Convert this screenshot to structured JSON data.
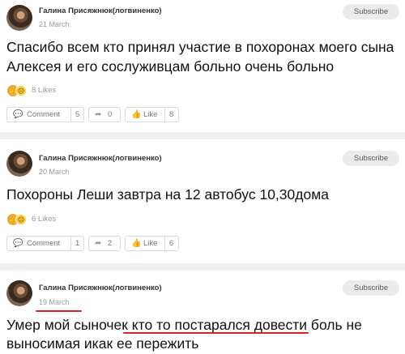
{
  "posts": [
    {
      "author": "Галина Присяжнюк(логвиненко)",
      "date": "21 March",
      "subscribe_label": "Subscribe",
      "text_lines": [
        "Спасибо всем кто принял участие в похоронах моего сына",
        "Алексея и его сослуживцам больно очень больно"
      ],
      "likes_label": "8 Likes",
      "comment_label": "Comment",
      "comment_count": "5",
      "share_count": "0",
      "like_label": "Like",
      "like_count": "8"
    },
    {
      "author": "Галина Присяжнюк(логвиненко)",
      "date": "20 March",
      "subscribe_label": "Subscribe",
      "text_lines": [
        "Похороны Леши завтра на 12 автобус 10,30дома"
      ],
      "likes_label": "6 Likes",
      "comment_label": "Comment",
      "comment_count": "1",
      "share_count": "2",
      "like_label": "Like",
      "like_count": "6"
    },
    {
      "author": "Галина Присяжнюк(логвиненко)",
      "date": "19 March",
      "subscribe_label": "Subscribe",
      "text_lines": [
        "Умер мой сыночек кто то постарался довести боль не",
        "выносимая икак ее пережить"
      ]
    }
  ],
  "icons": {
    "comment": "comment-icon",
    "share": "share-icon",
    "like": "thumbs-up-icon",
    "reaction_like": "like-reaction-icon",
    "reaction_sad": "sad-reaction-icon"
  },
  "colors": {
    "annotation_underline": "#e02020",
    "reaction_like": "#f5a623",
    "reaction_sad": "#ffd23f",
    "separator": "#f0f0f0"
  }
}
